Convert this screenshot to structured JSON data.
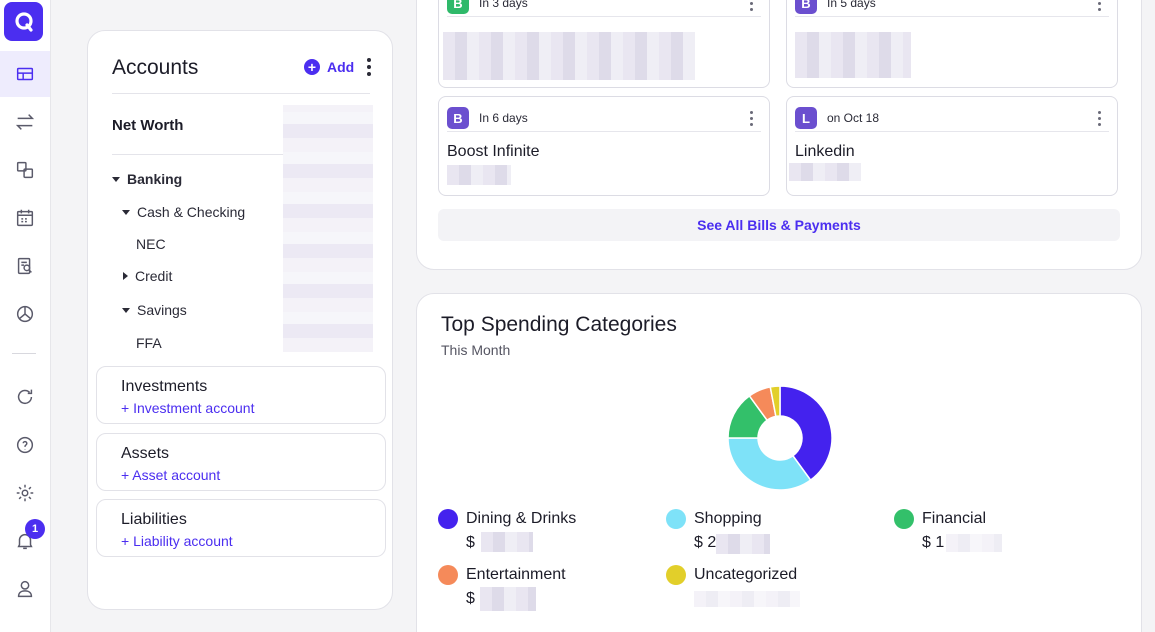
{
  "nav": {
    "items": [
      "dashboard",
      "transactions",
      "accounts",
      "calendar",
      "reports",
      "budget",
      "refresh",
      "help",
      "settings",
      "notifications",
      "profile"
    ],
    "notification_count": "1",
    "accent": "#4b2ef0"
  },
  "accounts": {
    "title": "Accounts",
    "add_label": "Add",
    "net_worth_label": "Net Worth",
    "tree": {
      "banking": "Banking",
      "cash_checking": "Cash & Checking",
      "nec": "NEC",
      "credit": "Credit",
      "savings": "Savings",
      "ffa": "FFA"
    },
    "sections": [
      {
        "title": "Investments",
        "link": "+ Investment account"
      },
      {
        "title": "Assets",
        "link": "+ Asset account"
      },
      {
        "title": "Liabilities",
        "link": "+ Liability account"
      }
    ]
  },
  "bills": {
    "items": [
      {
        "icon_letter": "B",
        "icon_color": "#2fb96a",
        "when": "In 3 days",
        "name": ""
      },
      {
        "icon_letter": "B",
        "icon_color": "#6b4fcf",
        "when": "In 5 days",
        "name": ""
      },
      {
        "icon_letter": "B",
        "icon_color": "#6b4fcf",
        "when": "In 6 days",
        "name": "Boost Infinite"
      },
      {
        "icon_letter": "L",
        "icon_color": "#6b4fcf",
        "when": "on Oct 18",
        "name": "Linkedin"
      }
    ],
    "see_all_label": "See All Bills & Payments"
  },
  "spending": {
    "title": "Top Spending Categories",
    "subtitle": "This Month",
    "categories": [
      {
        "name": "Dining & Drinks",
        "color": "#4422ee",
        "value_prefix": "$ "
      },
      {
        "name": "Shopping",
        "color": "#7ee2f8",
        "value_prefix": "$ 2"
      },
      {
        "name": "Financial",
        "color": "#33c06a",
        "value_prefix": "$ 1"
      },
      {
        "name": "Entertainment",
        "color": "#f58a5a",
        "value_prefix": "$ "
      },
      {
        "name": "Uncategorized",
        "color": "#e2cf2a",
        "value_prefix": ""
      }
    ],
    "donut_share_percent": [
      40,
      35,
      15,
      7,
      3
    ]
  }
}
